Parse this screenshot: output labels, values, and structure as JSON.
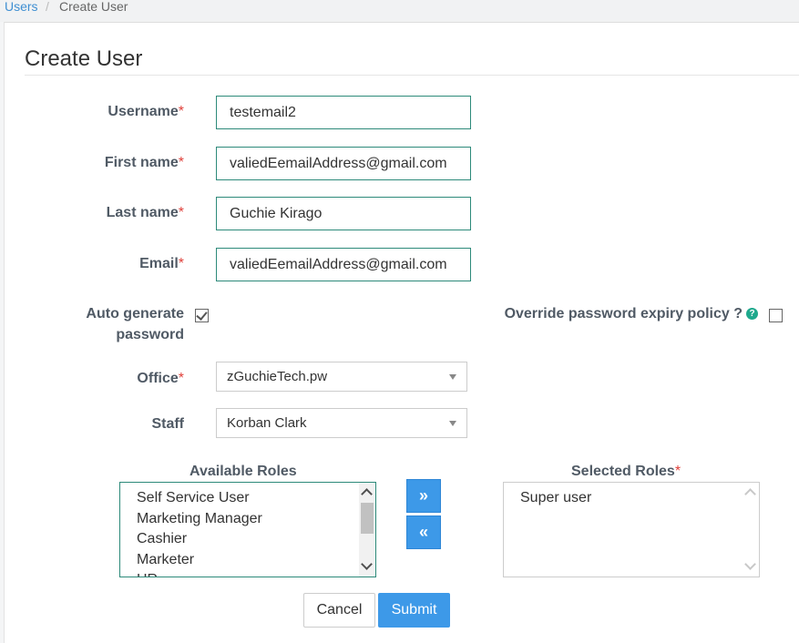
{
  "breadcrumb": {
    "parent": "Users",
    "separator": "/",
    "current": "Create User"
  },
  "page_title": "Create User",
  "required_marker": "*",
  "fields": {
    "username": {
      "label": "Username",
      "value": "testemail2"
    },
    "first_name": {
      "label": "First name",
      "value": "valiedEemailAddress@gmail.com"
    },
    "last_name": {
      "label": "Last name",
      "value": "Guchie Kirago"
    },
    "email": {
      "label": "Email",
      "value": "valiedEemailAddress@gmail.com"
    }
  },
  "auto_generate": {
    "label_line1": "Auto generate",
    "label_line2": "password",
    "checked": true
  },
  "override_policy": {
    "label": "Override password expiry policy ?",
    "help_icon": "question-circle-icon",
    "checked": false
  },
  "office": {
    "label": "Office",
    "selected": "zGuchieTech.pw"
  },
  "staff": {
    "label": "Staff",
    "selected": "Korban Clark"
  },
  "roles": {
    "available_label": "Available Roles",
    "available": [
      "Self Service User",
      "Marketing Manager",
      "Cashier",
      "Marketer",
      "HR"
    ],
    "selected_label": "Selected Roles",
    "selected": [
      "Super user"
    ],
    "add_glyph": "»",
    "remove_glyph": "«"
  },
  "actions": {
    "cancel": "Cancel",
    "submit": "Submit"
  },
  "colors": {
    "accent": "#3d99e8",
    "input_border": "#2d8a7a",
    "required": "#e0403a",
    "help": "#1fa98d"
  }
}
